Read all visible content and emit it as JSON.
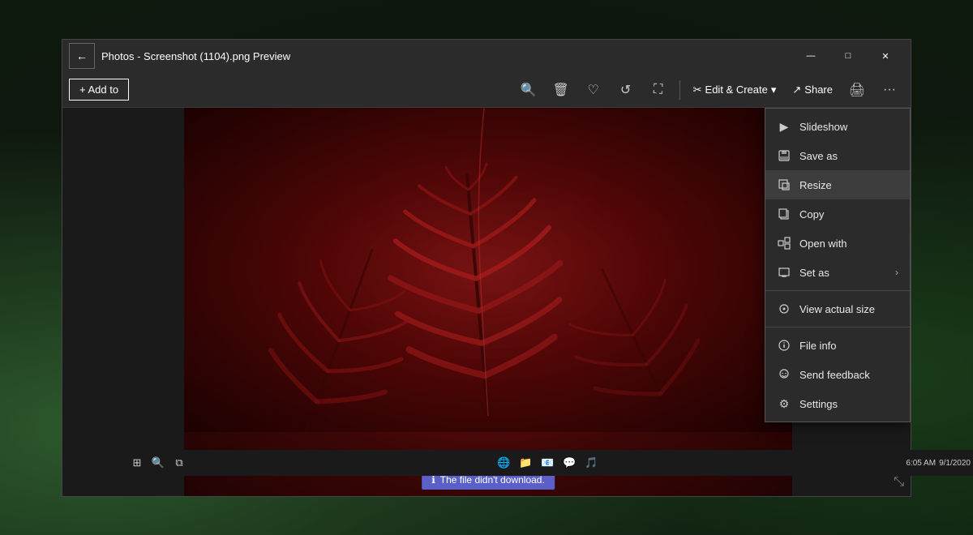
{
  "window": {
    "title": "Photos - Screenshot (1104).png Preview",
    "back_label": "←"
  },
  "toolbar": {
    "add_to_label": "+ Add to",
    "zoom_out_icon": "🔍",
    "delete_icon": "🗑",
    "favorite_icon": "♡",
    "rotate_icon": "↺",
    "crop_icon": "⛶",
    "edit_create_label": "Edit & Create",
    "share_label": "Share",
    "print_icon": "🖨",
    "more_icon": "···"
  },
  "context_menu": {
    "items": [
      {
        "id": "slideshow",
        "icon": "▶",
        "label": "Slideshow",
        "arrow": false
      },
      {
        "id": "save-as",
        "icon": "💾",
        "label": "Save as",
        "arrow": false
      },
      {
        "id": "resize",
        "icon": "⊡",
        "label": "Resize",
        "arrow": false,
        "highlighted": true
      },
      {
        "id": "copy",
        "icon": "📄",
        "label": "Copy",
        "arrow": false
      },
      {
        "id": "open-with",
        "icon": "⊞",
        "label": "Open with",
        "arrow": false
      },
      {
        "id": "set-as",
        "icon": "🖼",
        "label": "Set as",
        "arrow": true
      },
      {
        "id": "view-actual-size",
        "icon": "⊙",
        "label": "View actual size",
        "arrow": false
      },
      {
        "id": "file-info",
        "icon": "ℹ",
        "label": "File info",
        "arrow": false
      },
      {
        "id": "send-feedback",
        "icon": "😊",
        "label": "Send feedback",
        "arrow": false
      },
      {
        "id": "settings",
        "icon": "⚙",
        "label": "Settings",
        "arrow": false
      }
    ]
  },
  "notification": {
    "icon": "ℹ",
    "text": "The file didn't download."
  },
  "window_controls": {
    "minimize": "—",
    "maximize": "□",
    "close": "✕"
  }
}
